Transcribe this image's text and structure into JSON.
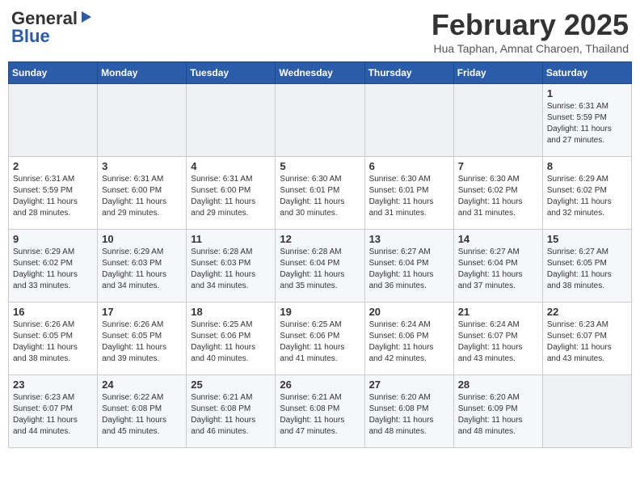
{
  "header": {
    "logo_line1": "General",
    "logo_line2": "Blue",
    "month": "February 2025",
    "location": "Hua Taphan, Amnat Charoen, Thailand"
  },
  "weekdays": [
    "Sunday",
    "Monday",
    "Tuesday",
    "Wednesday",
    "Thursday",
    "Friday",
    "Saturday"
  ],
  "weeks": [
    [
      {
        "day": "",
        "info": ""
      },
      {
        "day": "",
        "info": ""
      },
      {
        "day": "",
        "info": ""
      },
      {
        "day": "",
        "info": ""
      },
      {
        "day": "",
        "info": ""
      },
      {
        "day": "",
        "info": ""
      },
      {
        "day": "1",
        "info": "Sunrise: 6:31 AM\nSunset: 5:59 PM\nDaylight: 11 hours and 27 minutes."
      }
    ],
    [
      {
        "day": "2",
        "info": "Sunrise: 6:31 AM\nSunset: 5:59 PM\nDaylight: 11 hours and 28 minutes."
      },
      {
        "day": "3",
        "info": "Sunrise: 6:31 AM\nSunset: 6:00 PM\nDaylight: 11 hours and 29 minutes."
      },
      {
        "day": "4",
        "info": "Sunrise: 6:31 AM\nSunset: 6:00 PM\nDaylight: 11 hours and 29 minutes."
      },
      {
        "day": "5",
        "info": "Sunrise: 6:30 AM\nSunset: 6:01 PM\nDaylight: 11 hours and 30 minutes."
      },
      {
        "day": "6",
        "info": "Sunrise: 6:30 AM\nSunset: 6:01 PM\nDaylight: 11 hours and 31 minutes."
      },
      {
        "day": "7",
        "info": "Sunrise: 6:30 AM\nSunset: 6:02 PM\nDaylight: 11 hours and 31 minutes."
      },
      {
        "day": "8",
        "info": "Sunrise: 6:29 AM\nSunset: 6:02 PM\nDaylight: 11 hours and 32 minutes."
      }
    ],
    [
      {
        "day": "9",
        "info": "Sunrise: 6:29 AM\nSunset: 6:02 PM\nDaylight: 11 hours and 33 minutes."
      },
      {
        "day": "10",
        "info": "Sunrise: 6:29 AM\nSunset: 6:03 PM\nDaylight: 11 hours and 34 minutes."
      },
      {
        "day": "11",
        "info": "Sunrise: 6:28 AM\nSunset: 6:03 PM\nDaylight: 11 hours and 34 minutes."
      },
      {
        "day": "12",
        "info": "Sunrise: 6:28 AM\nSunset: 6:04 PM\nDaylight: 11 hours and 35 minutes."
      },
      {
        "day": "13",
        "info": "Sunrise: 6:27 AM\nSunset: 6:04 PM\nDaylight: 11 hours and 36 minutes."
      },
      {
        "day": "14",
        "info": "Sunrise: 6:27 AM\nSunset: 6:04 PM\nDaylight: 11 hours and 37 minutes."
      },
      {
        "day": "15",
        "info": "Sunrise: 6:27 AM\nSunset: 6:05 PM\nDaylight: 11 hours and 38 minutes."
      }
    ],
    [
      {
        "day": "16",
        "info": "Sunrise: 6:26 AM\nSunset: 6:05 PM\nDaylight: 11 hours and 38 minutes."
      },
      {
        "day": "17",
        "info": "Sunrise: 6:26 AM\nSunset: 6:05 PM\nDaylight: 11 hours and 39 minutes."
      },
      {
        "day": "18",
        "info": "Sunrise: 6:25 AM\nSunset: 6:06 PM\nDaylight: 11 hours and 40 minutes."
      },
      {
        "day": "19",
        "info": "Sunrise: 6:25 AM\nSunset: 6:06 PM\nDaylight: 11 hours and 41 minutes."
      },
      {
        "day": "20",
        "info": "Sunrise: 6:24 AM\nSunset: 6:06 PM\nDaylight: 11 hours and 42 minutes."
      },
      {
        "day": "21",
        "info": "Sunrise: 6:24 AM\nSunset: 6:07 PM\nDaylight: 11 hours and 43 minutes."
      },
      {
        "day": "22",
        "info": "Sunrise: 6:23 AM\nSunset: 6:07 PM\nDaylight: 11 hours and 43 minutes."
      }
    ],
    [
      {
        "day": "23",
        "info": "Sunrise: 6:23 AM\nSunset: 6:07 PM\nDaylight: 11 hours and 44 minutes."
      },
      {
        "day": "24",
        "info": "Sunrise: 6:22 AM\nSunset: 6:08 PM\nDaylight: 11 hours and 45 minutes."
      },
      {
        "day": "25",
        "info": "Sunrise: 6:21 AM\nSunset: 6:08 PM\nDaylight: 11 hours and 46 minutes."
      },
      {
        "day": "26",
        "info": "Sunrise: 6:21 AM\nSunset: 6:08 PM\nDaylight: 11 hours and 47 minutes."
      },
      {
        "day": "27",
        "info": "Sunrise: 6:20 AM\nSunset: 6:08 PM\nDaylight: 11 hours and 48 minutes."
      },
      {
        "day": "28",
        "info": "Sunrise: 6:20 AM\nSunset: 6:09 PM\nDaylight: 11 hours and 48 minutes."
      },
      {
        "day": "",
        "info": ""
      }
    ]
  ]
}
